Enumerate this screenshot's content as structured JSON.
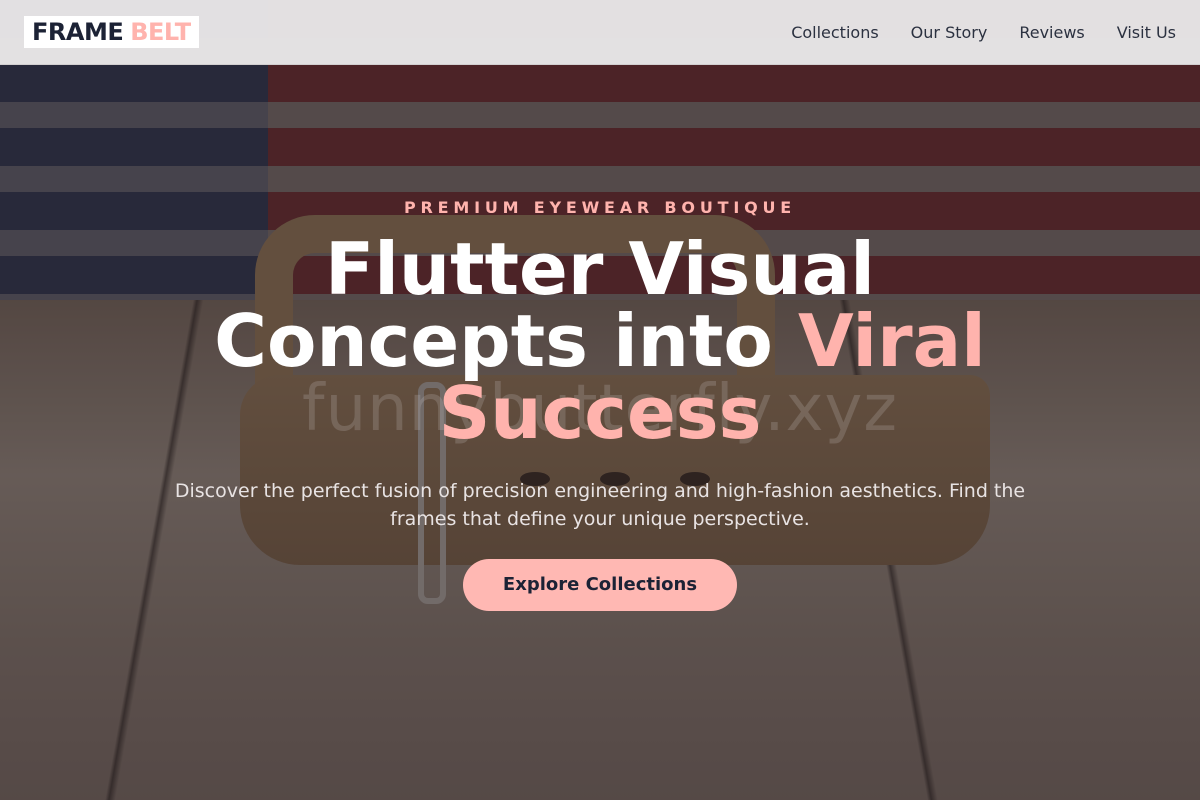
{
  "brand": {
    "name_main": "FRAME",
    "name_accent": "BELT"
  },
  "nav": {
    "items": [
      {
        "label": "Collections"
      },
      {
        "label": "Our Story"
      },
      {
        "label": "Reviews"
      },
      {
        "label": "Visit Us"
      }
    ]
  },
  "hero": {
    "eyebrow": "PREMIUM EYEWEAR BOUTIQUE",
    "title_line1": "Flutter Visual",
    "title_line2_plain": "Concepts into ",
    "title_line2_accent": "Viral",
    "title_line3_accent": "Success",
    "subtitle": "Discover the perfect fusion of precision engineering and high-fashion aesthetics. Find the frames that define your unique perspective.",
    "cta_label": "Explore Collections",
    "watermark": "funnybutterfly.xyz"
  },
  "colors": {
    "accent": "#ffb3ad",
    "navy": "#1c2235",
    "header_bg": "#e8e6e7",
    "cta_bg": "#ffb8b3"
  }
}
